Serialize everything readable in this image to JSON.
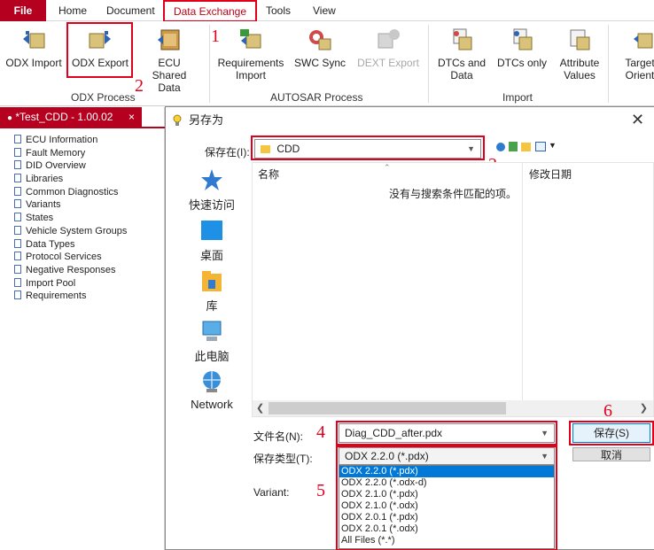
{
  "ribbon_tabs": {
    "file": "File",
    "home": "Home",
    "document": "Document",
    "data_exchange": "Data Exchange",
    "tools": "Tools",
    "view": "View"
  },
  "ribbon": {
    "odx_import": "ODX Import",
    "odx_export": "ODX Export",
    "ecu_shared_data": "ECU Shared Data",
    "requirements_import": "Requirements Import",
    "swc_sync": "SWC Sync",
    "dext_export": "DEXT Export",
    "dtcs_and_data": "DTCs and Data",
    "dtcs_only": "DTCs only",
    "attribute_values": "Attribute Values",
    "target_orient": "Target Orient",
    "group_odx_process": "ODX Process",
    "group_autosar_process": "AUTOSAR Process",
    "group_import": "Import"
  },
  "annotations": [
    "1",
    "2",
    "3",
    "4",
    "5",
    "6"
  ],
  "document_tab": {
    "title": "*Test_CDD - 1.00.02",
    "close": "×"
  },
  "tree": {
    "items": [
      "ECU Information",
      "Fault Memory",
      "DID Overview",
      "Libraries",
      "Common Diagnostics",
      "Variants",
      "States",
      "Vehicle System Groups",
      "Data Types",
      "Protocol Services",
      "Negative Responses",
      "Import Pool",
      "Requirements"
    ]
  },
  "dialog": {
    "title": "另存为",
    "save_in_label": "保存在(I):",
    "save_in_value": "CDD",
    "places": [
      "快速访问",
      "桌面",
      "库",
      "此电脑",
      "Network"
    ],
    "column_name": "名称",
    "column_date": "修改日期",
    "empty_message": "没有与搜索条件匹配的项。",
    "filename_label": "文件名(N):",
    "filename_value": "Diag_CDD_after.pdx",
    "filetype_label": "保存类型(T):",
    "filetype_value": "ODX 2.2.0 (*.pdx)",
    "variant_label": "Variant:",
    "save_button": "保存(S)",
    "cancel_button": "取消",
    "filetype_options": [
      "ODX 2.2.0 (*.pdx)",
      "ODX 2.2.0 (*.odx-d)",
      "ODX 2.1.0 (*.pdx)",
      "ODX 2.1.0 (*.odx)",
      "ODX 2.0.1 (*.pdx)",
      "ODX 2.0.1 (*.odx)",
      "All Files (*.*)"
    ]
  },
  "colors": {
    "brand": "#b5001f",
    "highlight": "#e0001b",
    "selection": "#0078d7"
  }
}
